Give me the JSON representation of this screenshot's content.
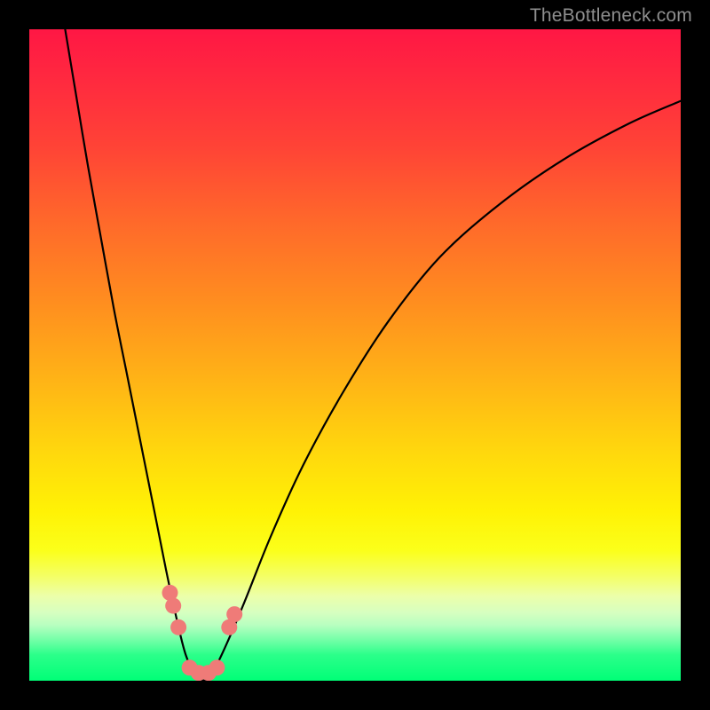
{
  "watermark": {
    "text": "TheBottleneck.com"
  },
  "colors": {
    "curve_stroke": "#000000",
    "dot_fill": "#ef7b78",
    "dot_stroke": "#d86562"
  },
  "chart_data": {
    "type": "line",
    "title": "",
    "xlabel": "",
    "ylabel": "",
    "xlim": [
      0,
      100
    ],
    "ylim": [
      0,
      100
    ],
    "grid": false,
    "legend": false,
    "annotations": [
      "TheBottleneck.com"
    ],
    "series": [
      {
        "name": "bottleneck-curve",
        "x": [
          5.5,
          7,
          9,
          11,
          13,
          15,
          17,
          19,
          21,
          22.5,
          24,
          25.5,
          27,
          28,
          30,
          33,
          37,
          42,
          48,
          55,
          63,
          72,
          82,
          92,
          100
        ],
        "values": [
          100,
          91,
          79,
          68,
          57,
          47,
          37,
          27,
          17,
          10,
          4,
          1,
          0,
          1,
          5,
          12,
          22,
          33,
          44,
          55,
          65,
          73,
          80,
          85.5,
          89
        ]
      }
    ],
    "points": [
      {
        "name": "left-cluster-upper-1",
        "x": 21.6,
        "y": 13.5
      },
      {
        "name": "left-cluster-upper-2",
        "x": 22.1,
        "y": 11.5
      },
      {
        "name": "left-cluster-upper-3",
        "x": 22.9,
        "y": 8.2
      },
      {
        "name": "right-cluster-upper-1",
        "x": 30.7,
        "y": 8.2
      },
      {
        "name": "right-cluster-upper-2",
        "x": 31.5,
        "y": 10.2
      },
      {
        "name": "valley-floor-1",
        "x": 24.6,
        "y": 2.0
      },
      {
        "name": "valley-floor-2",
        "x": 26.0,
        "y": 1.2
      },
      {
        "name": "valley-floor-3",
        "x": 27.5,
        "y": 1.2
      },
      {
        "name": "valley-floor-4",
        "x": 28.8,
        "y": 2.0
      }
    ]
  }
}
